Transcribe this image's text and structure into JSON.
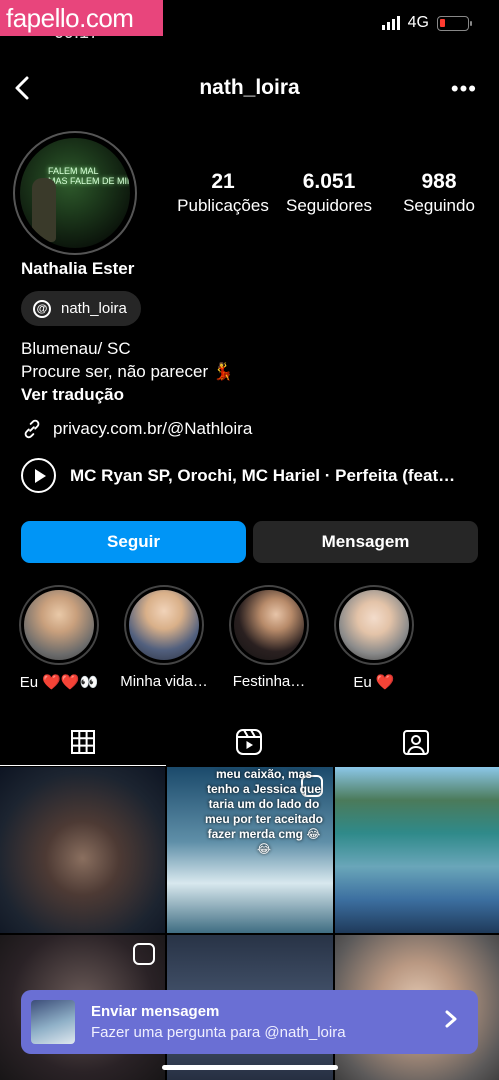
{
  "watermark": "fapello.com",
  "status": {
    "time": "09:17",
    "network": "4G"
  },
  "header": {
    "username": "nath_loira"
  },
  "profile": {
    "stats": [
      {
        "value": "21",
        "label": "Publicações"
      },
      {
        "value": "6.051",
        "label": "Seguidores"
      },
      {
        "value": "988",
        "label": "Seguindo"
      }
    ],
    "name": "Nathalia Ester",
    "threads_handle": "nath_loira",
    "bio_line1": "Blumenau/ SC",
    "bio_line2": "Procure ser, não parecer 💃",
    "translate": "Ver tradução",
    "link": "privacy.com.br/@Nathloira",
    "music": "MC Ryan SP, Orochi, MC Hariel · Perfeita (feat…",
    "avatar_sign": "FALEM MAL\nMAS FALEM DE MIM"
  },
  "buttons": {
    "follow": "Seguir",
    "message": "Mensagem"
  },
  "highlights": [
    {
      "label": "Eu ❤️❤️👀"
    },
    {
      "label": "Minha vida…"
    },
    {
      "label": "Festinha…"
    },
    {
      "label": "Eu ❤️"
    }
  ],
  "grid": {
    "post2_text": "meu caixão, mas tenho a Jessica que taria um do lado do meu por ter aceitado fazer merda cmg 😂😂"
  },
  "toast": {
    "title": "Enviar mensagem",
    "subtitle": "Fazer uma pergunta para @nath_loira"
  }
}
